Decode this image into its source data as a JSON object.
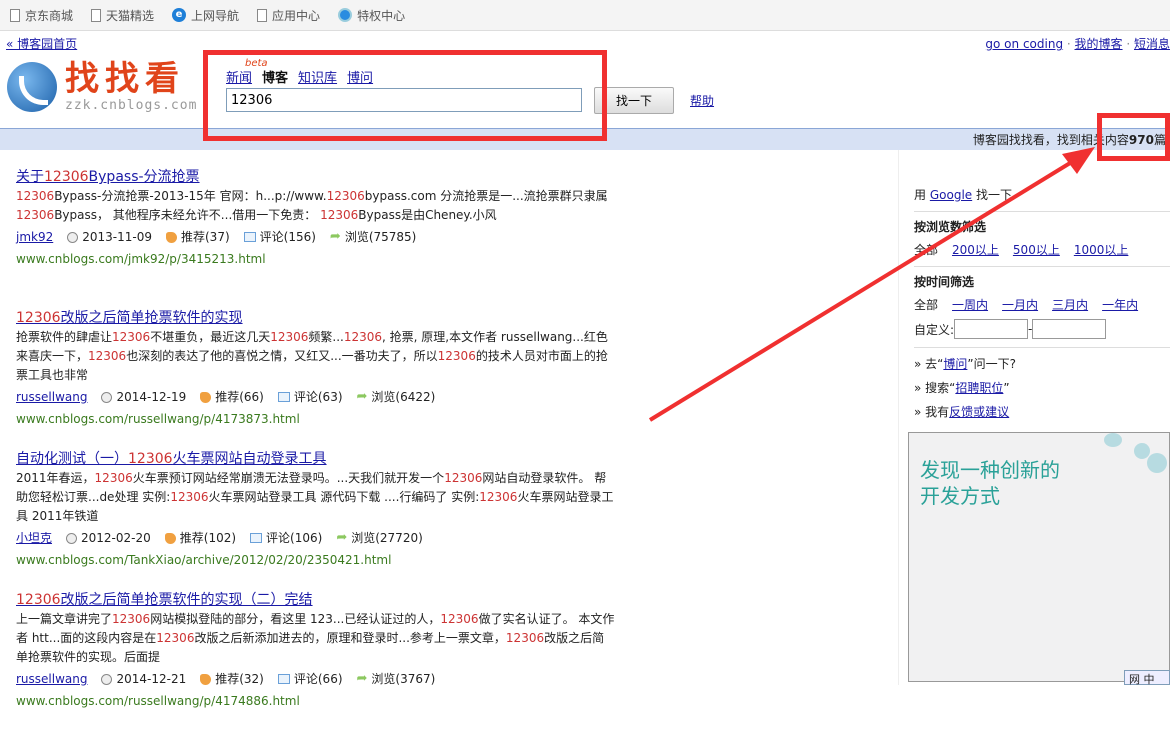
{
  "bookmarks": [
    {
      "label": "京东商城",
      "icon": "page-icon"
    },
    {
      "label": "天猫精选",
      "icon": "page-icon"
    },
    {
      "label": "上网导航",
      "icon": "ie-icon"
    },
    {
      "label": "应用中心",
      "icon": "page-icon"
    },
    {
      "label": "特权中心",
      "icon": "privilege-icon"
    }
  ],
  "top_links": {
    "home": "« 博客园首页",
    "user": "go on coding",
    "my_blog": "我的博客",
    "messages": "短消息",
    "sep": " · "
  },
  "logo": {
    "title": "找找看",
    "domain": "zzk.cnblogs.com",
    "beta": "beta"
  },
  "search": {
    "tabs": [
      {
        "label": "新闻",
        "active": false
      },
      {
        "label": "博客",
        "active": true
      },
      {
        "label": "知识库",
        "active": false
      },
      {
        "label": "博问",
        "active": false
      }
    ],
    "query": "12306",
    "button": "找一下",
    "help": "帮助"
  },
  "result_bar": {
    "prefix": "博客园找找看，找到相关内容",
    "count": "970",
    "suffix": "篇"
  },
  "results": [
    {
      "title": [
        [
          "关于",
          0
        ],
        [
          "12306",
          1
        ],
        [
          "Bypass-分流抢票",
          0
        ]
      ],
      "snippet": [
        [
          "12306",
          1
        ],
        [
          "Bypass-分流抢票-2013-15年 官网：h...p://www.",
          0
        ],
        [
          "12306",
          1
        ],
        [
          "bypass.com 分流抢票是一...流抢票群只隶属 ",
          0
        ],
        [
          "12306",
          1
        ],
        [
          "Bypass， 其他程序未经允许不...借用一下免责： ",
          0
        ],
        [
          "12306",
          1
        ],
        [
          "Bypass是由Cheney.小风",
          0
        ]
      ],
      "author": "jmk92",
      "date": "2013-11-09",
      "recommend": "推荐(37)",
      "comments": "评论(156)",
      "views": "浏览(75785)",
      "url": "www.cnblogs.com/jmk92/p/3415213.html"
    },
    {
      "title": [
        [
          "12306",
          1
        ],
        [
          "改版之后简单抢票软件的实现",
          0
        ]
      ],
      "snippet": [
        [
          "抢票软件的肆虐让",
          0
        ],
        [
          "12306",
          1
        ],
        [
          "不堪重负，最近这几天",
          0
        ],
        [
          "12306",
          1
        ],
        [
          "频繁...",
          0
        ],
        [
          "12306",
          1
        ],
        [
          ", 抢票, 原理,本文作者 russellwang...红色来喜庆一下，",
          0
        ],
        [
          "12306",
          1
        ],
        [
          "也深刻的表达了他的喜悦之情，又红又...一番功夫了，所以",
          0
        ],
        [
          "12306",
          1
        ],
        [
          "的技术人员对市面上的抢票工具也非常",
          0
        ]
      ],
      "author": "russellwang",
      "date": "2014-12-19",
      "recommend": "推荐(66)",
      "comments": "评论(63)",
      "views": "浏览(6422)",
      "url": "www.cnblogs.com/russellwang/p/4173873.html"
    },
    {
      "title": [
        [
          "自动化测试（一）",
          0
        ],
        [
          "12306",
          1
        ],
        [
          "火车票网站自动登录工具",
          0
        ]
      ],
      "snippet": [
        [
          "2011年春运，",
          0
        ],
        [
          "12306",
          1
        ],
        [
          "火车票预订网站经常崩溃无法登录吗。...天我们就开发一个",
          0
        ],
        [
          "12306",
          1
        ],
        [
          "网站自动登录软件。 帮助您轻松订票...de处理 实例:",
          0
        ],
        [
          "12306",
          1
        ],
        [
          "火车票网站登录工具 源代码下载 ....行编码了 实例:",
          0
        ],
        [
          "12306",
          1
        ],
        [
          "火车票网站登录工具 2011年铁道",
          0
        ]
      ],
      "author": "小坦克",
      "date": "2012-02-20",
      "recommend": "推荐(102)",
      "comments": "评论(106)",
      "views": "浏览(27720)",
      "url": "www.cnblogs.com/TankXiao/archive/2012/02/20/2350421.html"
    },
    {
      "title": [
        [
          "12306",
          1
        ],
        [
          "改版之后简单抢票软件的实现（二）完结",
          0
        ]
      ],
      "snippet": [
        [
          "上一篇文章讲完了",
          0
        ],
        [
          "12306",
          1
        ],
        [
          "网站模拟登陆的部分，看这里 123...已经认证过的人，",
          0
        ],
        [
          "12306",
          1
        ],
        [
          "做了实名认证了。 本文作者 htt...面的这段内容是在",
          0
        ],
        [
          "12306",
          1
        ],
        [
          "改版之后新添加进去的，原理和登录时...参考上一票文章，",
          0
        ],
        [
          "12306",
          1
        ],
        [
          "改版之后简单抢票软件的实现。后面提",
          0
        ]
      ],
      "author": "russellwang",
      "date": "2014-12-21",
      "recommend": "推荐(32)",
      "comments": "评论(66)",
      "views": "浏览(3767)",
      "url": "www.cnblogs.com/russellwang/p/4174886.html"
    }
  ],
  "sidebar": {
    "google": {
      "pre": "用",
      "link": "Google",
      "post": "找一下"
    },
    "views_filter": {
      "title": "按浏览数筛选",
      "all": "全部",
      "options": [
        "200以上",
        "500以上",
        "1000以上"
      ]
    },
    "time_filter": {
      "title": "按时间筛选",
      "all": "全部",
      "options": [
        "一周内",
        "一月内",
        "三月内",
        "一年内"
      ],
      "custom": "自定义:",
      "dash": "-"
    },
    "links": [
      {
        "pre": "» 去“",
        "link": "博问",
        "post": "”问一下?"
      },
      {
        "pre": "» 搜索“",
        "link": "招聘职位",
        "post": "”"
      },
      {
        "pre": "» 我有",
        "link": "反馈或建议",
        "post": ""
      }
    ]
  },
  "ad": {
    "line1": "发现一种创新的",
    "line2": "开发方式"
  },
  "chat_widget": "网 中",
  "colors": {
    "highlight": "#cc3333",
    "annotation": "#f03030",
    "link": "#1a1aa6",
    "url": "#3a7a1e"
  }
}
